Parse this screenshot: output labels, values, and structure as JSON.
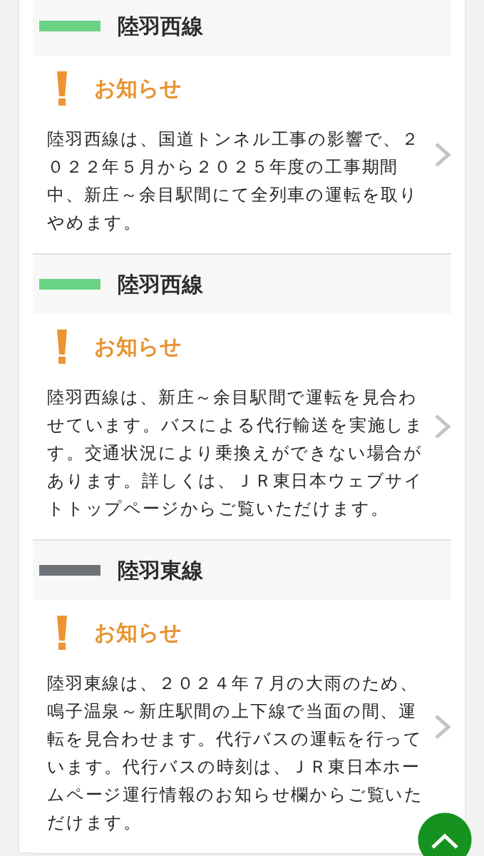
{
  "sections": [
    {
      "name": "陸羽西線",
      "color": "#6ad384",
      "notice": {
        "label": "お知らせ",
        "text": "陸羽西線は、国道トンネル工事の影響で、２０２２年５月から２０２５年度の工事期間中、新庄～余目駅間にて全列車の運転を取りやめます。"
      }
    },
    {
      "name": "陸羽西線",
      "color": "#6ad384",
      "notice": {
        "label": "お知らせ",
        "text": "陸羽西線は、新庄～余目駅間で運転を見合わせています。バスによる代行輸送を実施します。交通状況により乗換えができない場合があります。詳しくは、ＪＲ東日本ウェブサイトトップページからご覧いただけます。"
      }
    },
    {
      "name": "陸羽東線",
      "color": "#6e7378",
      "notice": {
        "label": "お知らせ",
        "text": "陸羽東線は、２０２４年７月の大雨のため、鳴子温泉～新庄駅間の上下線で当面の間、運転を見合わせます。代行バスの運転を行っています。代行バスの時刻は、ＪＲ東日本ホームページ運行情報のお知らせ欄からご覧いただけます。"
      }
    }
  ]
}
